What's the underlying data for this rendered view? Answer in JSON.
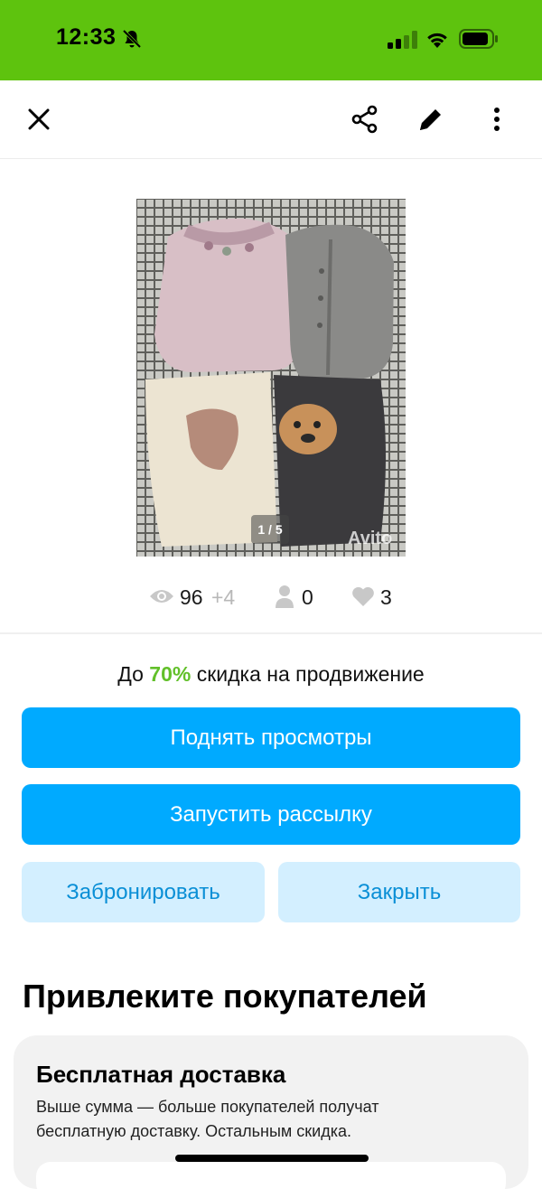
{
  "status_bar": {
    "time": "12:33",
    "bg_color": "#5ec30e"
  },
  "nav": {
    "icons": [
      "close-icon",
      "share-icon",
      "edit-icon",
      "more-vertical-icon"
    ]
  },
  "photo": {
    "counter": "1 / 5",
    "watermark": "Avito"
  },
  "stats": {
    "views": "96",
    "views_delta": "+4",
    "contacts": "0",
    "favorites": "3"
  },
  "promo": {
    "prefix": "До",
    "percent": "70%",
    "suffix": "скидка на продвижение"
  },
  "buttons": {
    "raise_views": "Поднять просмотры",
    "start_mailing": "Запустить рассылку",
    "reserve": "Забронировать",
    "close": "Закрыть"
  },
  "section": {
    "title": "Привлеките покупателей",
    "card_title": "Бесплатная доставка",
    "card_text": "Выше сумма — больше покупателей получат бесплатную доставку. Остальным скидка."
  },
  "colors": {
    "accent_blue": "#00aaff",
    "light_blue": "#d3efff",
    "promo_green": "#62c02a"
  }
}
